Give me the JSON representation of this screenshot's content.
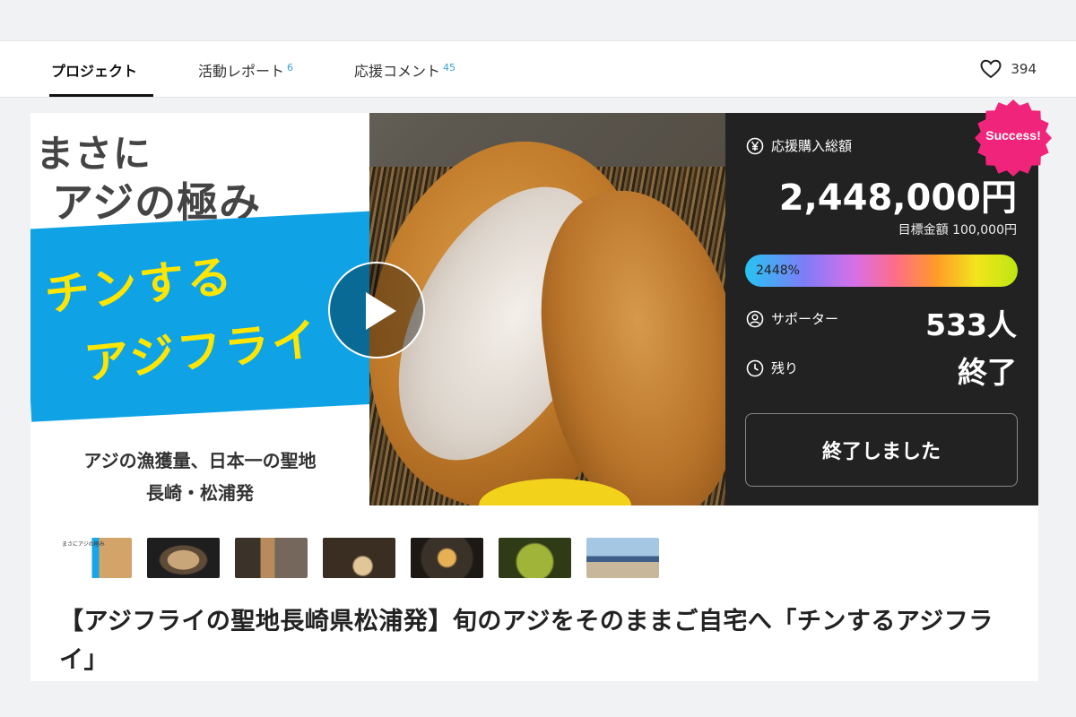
{
  "tabs": [
    {
      "label": "プロジェクト",
      "count": ""
    },
    {
      "label": "活動レポート",
      "count": "6"
    },
    {
      "label": "応援コメント",
      "count": "45"
    }
  ],
  "likes": "394",
  "promo": {
    "head1": "まさに",
    "head2": "アジの極み",
    "line1": "チンする",
    "line2": "アジフライ",
    "sub1": "アジの漁獲量、日本一の聖地",
    "sub2": "長崎・松浦発"
  },
  "stats": {
    "badge": "Success!",
    "total_label": "応援購入総額",
    "total_amount": "2,448,000円",
    "goal": "目標金額 100,000円",
    "progress_text": "2448%",
    "progress_percent": 2448,
    "supporters_label": "サポーター",
    "supporters_value": "533人",
    "remaining_label": "残り",
    "remaining_value": "終了",
    "ended_button": "終了しました"
  },
  "thumbnails": [
    "まさにアジの極み",
    "",
    "",
    "",
    "",
    "",
    ""
  ],
  "project_title": "【アジフライの聖地長崎県松浦発】旬のアジをそのままご自宅へ「チンするアジフライ」",
  "colors": {
    "badge": "#f0247a",
    "panel": "#222222",
    "tab_count": "#3aa1d4"
  }
}
